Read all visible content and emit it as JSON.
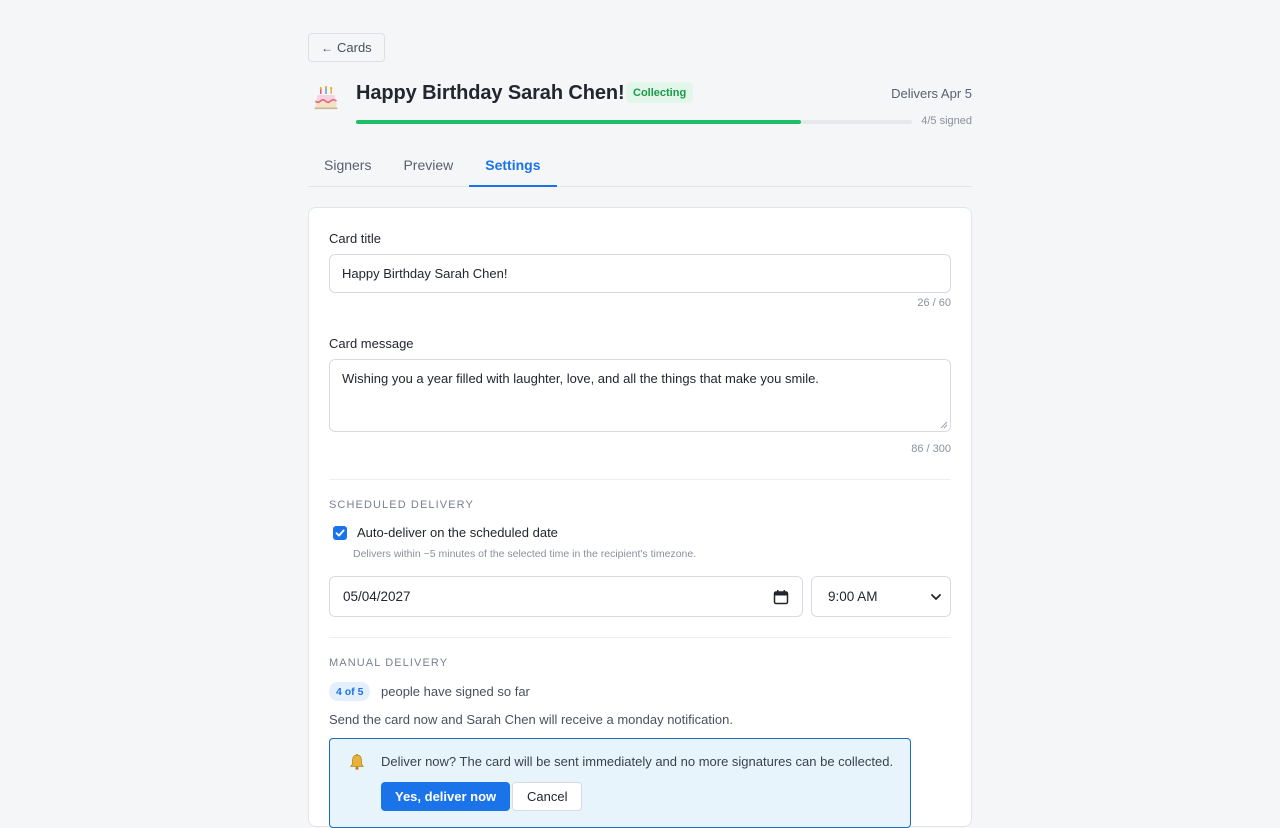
{
  "nav": {
    "back_label": "Cards",
    "back_icon": "arrow-left-icon"
  },
  "header": {
    "icon": "birthday-cake-icon",
    "title": "Happy Birthday Sarah Chen!",
    "status": "Collecting",
    "status_color": "#1a9a4a",
    "delivery": "Delivers Apr 5",
    "progress_fraction": 0.8,
    "signed_count": "4/5 signed"
  },
  "tabs": [
    {
      "label": "Signers",
      "active": false
    },
    {
      "label": "Preview",
      "active": false
    },
    {
      "label": "Settings",
      "active": true
    }
  ],
  "settings": {
    "title_label": "Card title",
    "title_value": "Happy Birthday Sarah Chen!",
    "title_counter": "26 / 60",
    "message_label": "Card message",
    "message_value": "Wishing you a year filled with laughter, love, and all the things that make you smile.",
    "message_counter": "86 / 300"
  },
  "scheduled": {
    "section_title": "SCHEDULED DELIVERY",
    "auto_deliver_label": "Auto-deliver on the scheduled date",
    "auto_deliver_checked": true,
    "helper": "Delivers within ~5 minutes of the selected time in the recipient's timezone.",
    "date_value": "05/04/2027",
    "time_value": "9:00 AM"
  },
  "manual": {
    "section_title": "MANUAL DELIVERY",
    "count_badge": "4 of 5",
    "count_text": "people have signed so far",
    "send_text": "Send the card now and Sarah Chen will receive a monday notification.",
    "confirm_text": "Deliver now? The card will be sent immediately and no more signatures can be collected.",
    "confirm_button": "Yes, deliver now",
    "cancel_button": "Cancel"
  },
  "colors": {
    "accent": "#1a73e8",
    "progress": "#1cbf66"
  }
}
